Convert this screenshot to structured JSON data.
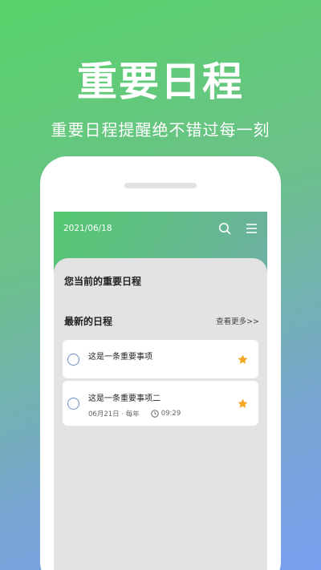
{
  "promo": {
    "headline": "重要日程",
    "subline": "重要日程提醒绝不错过每一刻"
  },
  "app": {
    "date": "2021/06/18",
    "icons": [
      "search-icon",
      "menu-icon"
    ],
    "panel_title": "您当前的重要日程",
    "section_title": "最新的日程",
    "more_link": "查看更多>>",
    "items": [
      {
        "title": "这是一条重要事项",
        "starred": true
      },
      {
        "title": "这是一条重要事项二",
        "date_repeat": "06月21日 · 每年",
        "time": "09:29",
        "starred": true
      }
    ]
  },
  "colors": {
    "accent_star": "#f5a623",
    "check_ring": "#6a8fc9",
    "panel_bg": "#e3e3e3"
  }
}
